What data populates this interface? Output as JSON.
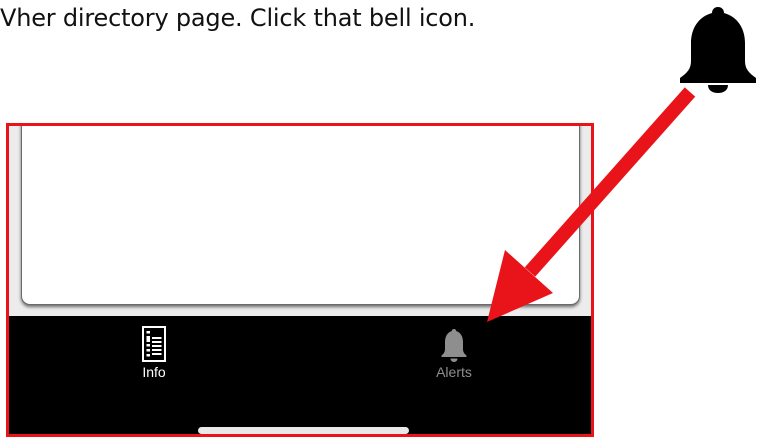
{
  "instruction": {
    "text": "Vher directory page.  Click that bell icon."
  },
  "annotation": {
    "frame_color": "#e8141a",
    "arrow_color": "#e8141a",
    "callout_icon": "bell-icon"
  },
  "tab_bar": {
    "tabs": [
      {
        "label": "Info",
        "icon": "document-list-icon",
        "state": "selected",
        "color": "#ffffff"
      },
      {
        "label": "Alerts",
        "icon": "bell-icon",
        "state": "unselected",
        "color": "#8e8e8e"
      }
    ]
  },
  "colors": {
    "tab_bar_background": "#000000",
    "content_background": "#ececec",
    "card_background": "#ffffff",
    "home_indicator": "#e9e9e9"
  }
}
